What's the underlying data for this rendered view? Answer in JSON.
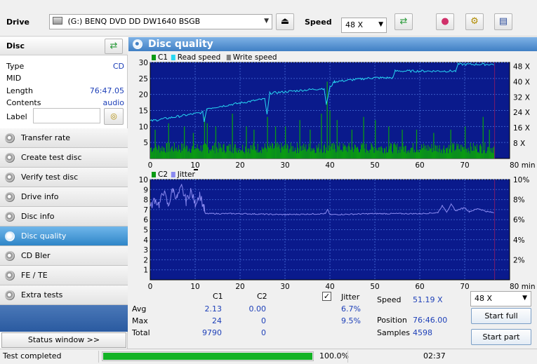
{
  "toolbar": {
    "drive_label": "Drive",
    "drive_value": "(G:)  BENQ DVD DD DW1640 BSGB",
    "speed_label": "Speed",
    "speed_value": "48 X"
  },
  "disc": {
    "title": "Disc",
    "fields": [
      {
        "key": "Type",
        "value": "CD"
      },
      {
        "key": "MID",
        "value": ""
      },
      {
        "key": "Length",
        "value": "76:47.05"
      },
      {
        "key": "Contents",
        "value": "audio"
      },
      {
        "key": "Label",
        "value": ""
      }
    ]
  },
  "nav": [
    {
      "label": "Transfer rate",
      "active": false
    },
    {
      "label": "Create test disc",
      "active": false
    },
    {
      "label": "Verify test disc",
      "active": false
    },
    {
      "label": "Drive info",
      "active": false
    },
    {
      "label": "Disc info",
      "active": false
    },
    {
      "label": "Disc quality",
      "active": true
    },
    {
      "label": "CD Bler",
      "active": false
    },
    {
      "label": "FE / TE",
      "active": false
    },
    {
      "label": "Extra tests",
      "active": false
    }
  ],
  "status_window_label": "Status window >>",
  "panel_title": "Disc quality",
  "colors": {
    "c1": "#0a9a14",
    "read_speed": "#27d7f2",
    "write_speed": "#808080",
    "c2": "#0a9a14",
    "jitter": "#8a8af0",
    "plot_bg": "#0a1a8c",
    "grid": "#3a5cc8",
    "progress": "#13b325"
  },
  "chart_data": [
    {
      "type": "bar",
      "legend": [
        "C1",
        "Read speed",
        "Write speed"
      ],
      "x_ticks": [
        0,
        10,
        20,
        30,
        40,
        50,
        60,
        70,
        80
      ],
      "x_unit": "min",
      "xlim": [
        0,
        80
      ],
      "y_left_ticks": [
        5,
        10,
        15,
        20,
        25,
        30
      ],
      "y_left_lim": [
        0,
        30
      ],
      "y_right_ticks": [
        "8 X",
        "16 X",
        "24 X",
        "32 X",
        "40 X",
        "48 X"
      ],
      "y_right_lim": [
        0,
        50
      ],
      "c1_typical_max": 5,
      "c1_max": 24,
      "c1_spikes": [
        {
          "x": 1.0,
          "y": 9
        },
        {
          "x": 4.0,
          "y": 11
        },
        {
          "x": 7.5,
          "y": 10
        },
        {
          "x": 9.5,
          "y": 8
        },
        {
          "x": 12.0,
          "y": 13
        },
        {
          "x": 12.6,
          "y": 11
        },
        {
          "x": 14.5,
          "y": 10
        },
        {
          "x": 18.2,
          "y": 14
        },
        {
          "x": 21.3,
          "y": 10
        },
        {
          "x": 23.0,
          "y": 9
        },
        {
          "x": 26.0,
          "y": 13
        },
        {
          "x": 27.8,
          "y": 10
        },
        {
          "x": 30.0,
          "y": 10
        },
        {
          "x": 33.2,
          "y": 12
        },
        {
          "x": 35.5,
          "y": 9
        },
        {
          "x": 38.0,
          "y": 14
        },
        {
          "x": 39.3,
          "y": 24
        },
        {
          "x": 39.9,
          "y": 15
        },
        {
          "x": 41.5,
          "y": 12
        },
        {
          "x": 44.8,
          "y": 9
        },
        {
          "x": 47.4,
          "y": 13
        },
        {
          "x": 50.0,
          "y": 12
        },
        {
          "x": 53.0,
          "y": 10
        },
        {
          "x": 56.0,
          "y": 9
        },
        {
          "x": 59.2,
          "y": 9
        },
        {
          "x": 63.0,
          "y": 8
        },
        {
          "x": 66.8,
          "y": 9
        },
        {
          "x": 70.0,
          "y": 10
        },
        {
          "x": 74.0,
          "y": 13
        },
        {
          "x": 75.4,
          "y": 9
        }
      ],
      "read_speed": [
        {
          "x": 0,
          "y": 19.5
        },
        {
          "x": 11.7,
          "y": 24
        },
        {
          "x": 12,
          "y": 19
        },
        {
          "x": 12.6,
          "y": 26
        },
        {
          "x": 25.5,
          "y": 31
        },
        {
          "x": 26,
          "y": 23
        },
        {
          "x": 26.6,
          "y": 34
        },
        {
          "x": 38.7,
          "y": 36.5
        },
        {
          "x": 39.2,
          "y": 28
        },
        {
          "x": 40,
          "y": 37
        },
        {
          "x": 41,
          "y": 40
        },
        {
          "x": 49.5,
          "y": 42
        },
        {
          "x": 54,
          "y": 42
        },
        {
          "x": 54.5,
          "y": 45.5
        },
        {
          "x": 68,
          "y": 45.5
        },
        {
          "x": 68.5,
          "y": 49
        },
        {
          "x": 76.5,
          "y": 49
        }
      ]
    },
    {
      "type": "line",
      "legend": [
        "C2",
        "Jitter"
      ],
      "x_ticks": [
        0,
        10,
        20,
        30,
        40,
        50,
        60,
        70,
        80
      ],
      "x_unit": "min",
      "xlim": [
        0,
        80
      ],
      "y_left_ticks": [
        1,
        2,
        3,
        4,
        5,
        6,
        7,
        8,
        9,
        10
      ],
      "y_left_lim": [
        0,
        10
      ],
      "y_right_ticks": [
        "2%",
        "4%",
        "6%",
        "8%",
        "10%"
      ],
      "y_right_lim": [
        0,
        10
      ],
      "jitter": [
        {
          "x": 0,
          "y": 7.2
        },
        {
          "x": 1,
          "y": 8.0
        },
        {
          "x": 2,
          "y": 7.5
        },
        {
          "x": 3,
          "y": 8.8
        },
        {
          "x": 4,
          "y": 7.4
        },
        {
          "x": 5,
          "y": 9.0
        },
        {
          "x": 6,
          "y": 8.2
        },
        {
          "x": 7,
          "y": 9.2
        },
        {
          "x": 8,
          "y": 7.8
        },
        {
          "x": 9,
          "y": 8.9
        },
        {
          "x": 10,
          "y": 7.6
        },
        {
          "x": 11,
          "y": 8.6
        },
        {
          "x": 12,
          "y": 7.1
        },
        {
          "x": 12.3,
          "y": 6.6
        },
        {
          "x": 20,
          "y": 6.6
        },
        {
          "x": 30,
          "y": 6.5
        },
        {
          "x": 39,
          "y": 6.6
        },
        {
          "x": 39.5,
          "y": 7.0
        },
        {
          "x": 40,
          "y": 6.5
        },
        {
          "x": 50,
          "y": 6.6
        },
        {
          "x": 60,
          "y": 6.6
        },
        {
          "x": 64,
          "y": 6.7
        },
        {
          "x": 65,
          "y": 7.4
        },
        {
          "x": 66,
          "y": 6.8
        },
        {
          "x": 67,
          "y": 7.5
        },
        {
          "x": 68,
          "y": 6.9
        },
        {
          "x": 70,
          "y": 7.2
        },
        {
          "x": 71,
          "y": 6.8
        },
        {
          "x": 73,
          "y": 7.1
        },
        {
          "x": 75,
          "y": 6.8
        },
        {
          "x": 76.5,
          "y": 6.7
        }
      ],
      "c2": []
    }
  ],
  "stats": {
    "col_c1": "C1",
    "col_c2": "C2",
    "col_jitter": "Jitter",
    "jitter_checked": true,
    "rows": [
      {
        "label": "Avg",
        "c1": "2.13",
        "c2": "0.00",
        "jitter": "6.7%"
      },
      {
        "label": "Max",
        "c1": "24",
        "c2": "0",
        "jitter": "9.5%"
      },
      {
        "label": "Total",
        "c1": "9790",
        "c2": "0",
        "jitter": ""
      }
    ],
    "speed_label": "Speed",
    "speed_value": "51.19 X",
    "position_label": "Position",
    "position_value": "76:46.00",
    "samples_label": "Samples",
    "samples_value": "4598",
    "speed_select": "48 X",
    "start_full": "Start full",
    "start_part": "Start part"
  },
  "status": {
    "text": "Test completed",
    "progress": 1.0,
    "percent": "100.0%",
    "elapsed": "02:37"
  }
}
